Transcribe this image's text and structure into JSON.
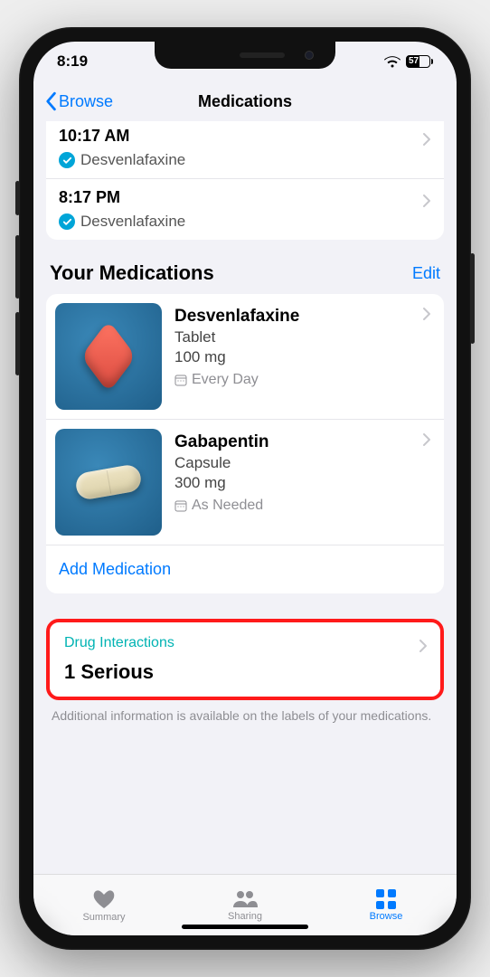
{
  "status": {
    "time": "8:19",
    "battery": "57"
  },
  "nav": {
    "back": "Browse",
    "title": "Medications"
  },
  "log": [
    {
      "time": "10:17 AM",
      "med": "Desvenlafaxine"
    },
    {
      "time": "8:17 PM",
      "med": "Desvenlafaxine"
    }
  ],
  "meds_section": {
    "title": "Your Medications",
    "edit": "Edit"
  },
  "meds": [
    {
      "name": "Desvenlafaxine",
      "form": "Tablet",
      "dose": "100 mg",
      "schedule": "Every Day"
    },
    {
      "name": "Gabapentin",
      "form": "Capsule",
      "dose": "300 mg",
      "schedule": "As Needed"
    }
  ],
  "add": "Add Medication",
  "interactions": {
    "label": "Drug Interactions",
    "count": "1 Serious"
  },
  "disclaimer": "Additional information is available on the labels of your medications.",
  "tabs": {
    "summary": "Summary",
    "sharing": "Sharing",
    "browse": "Browse"
  }
}
